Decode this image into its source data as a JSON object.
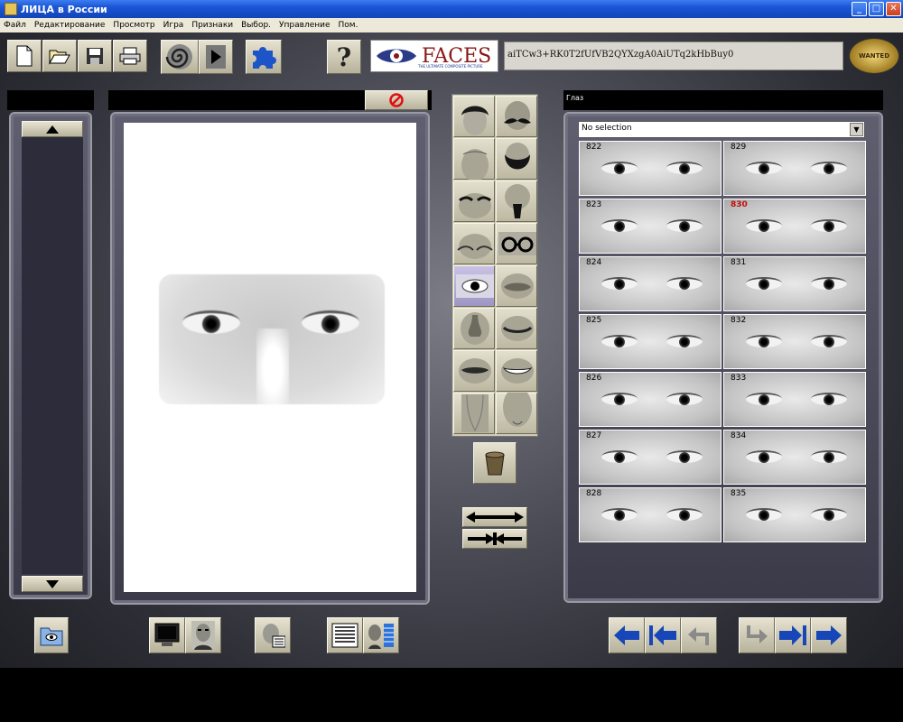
{
  "window": {
    "title": "ЛИЦА в России",
    "minimize_glyph": "_",
    "maximize_glyph": "□",
    "close_glyph": "✕"
  },
  "menu": [
    "Файл",
    "Редактирование",
    "Просмотр",
    "Игра",
    "Признаки",
    "Выбор.",
    "Управление",
    "Пом."
  ],
  "toolbar": {
    "icons": [
      "new-file-icon",
      "open-folder-icon",
      "save-disk-icon",
      "print-icon",
      "spiral-icon",
      "play-icon",
      "puzzle-icon",
      "help-icon"
    ],
    "help_label": "?",
    "logo_text": "FACES",
    "logo_subtext": "THE ULTIMATE COMPOSITE PICTURE",
    "face_code": "aiTCw3+RK0T2fUfVB2QYXzgA0AiUTq2kHbBuy0",
    "wanted_logo": "WANTED"
  },
  "cancel_icon": "no-sign-icon",
  "feature_categories": [
    {
      "id": "hair",
      "icon": "hair-icon"
    },
    {
      "id": "mustache",
      "icon": "mustache-icon"
    },
    {
      "id": "forehead",
      "icon": "forehead-icon"
    },
    {
      "id": "beard",
      "icon": "beard-icon"
    },
    {
      "id": "eyebrows",
      "icon": "eyebrows-icon"
    },
    {
      "id": "goatee",
      "icon": "goatee-icon"
    },
    {
      "id": "brow-line",
      "icon": "brow-line-icon"
    },
    {
      "id": "glasses",
      "icon": "glasses-icon"
    },
    {
      "id": "eyes",
      "icon": "eyes-icon",
      "active": true
    },
    {
      "id": "lips-closed",
      "icon": "lips-icon"
    },
    {
      "id": "nose",
      "icon": "nose-icon"
    },
    {
      "id": "mouth-lower",
      "icon": "mouth-icon"
    },
    {
      "id": "mouth",
      "icon": "mouth-open-icon"
    },
    {
      "id": "smile",
      "icon": "smile-icon"
    },
    {
      "id": "neck",
      "icon": "neck-icon"
    },
    {
      "id": "chin",
      "icon": "chin-icon"
    }
  ],
  "eyes_panel": {
    "header": "Глаз",
    "selection": "No selection",
    "selected_id": "830",
    "left_column": [
      "822",
      "823",
      "824",
      "825",
      "826",
      "827",
      "828"
    ],
    "right_column": [
      "829",
      "830",
      "831",
      "832",
      "833",
      "834",
      "835"
    ]
  },
  "bottom_toolbar_left": [
    "photo-folder-icon",
    "monitor-icon",
    "face-portrait-icon",
    "face-edit-icon",
    "text-document-icon",
    "face-list-icon"
  ],
  "bottom_toolbar_right": [
    "arrow-left-icon",
    "arrow-first-icon",
    "undo-icon",
    "redo-icon",
    "arrow-last-icon",
    "arrow-right-icon"
  ]
}
